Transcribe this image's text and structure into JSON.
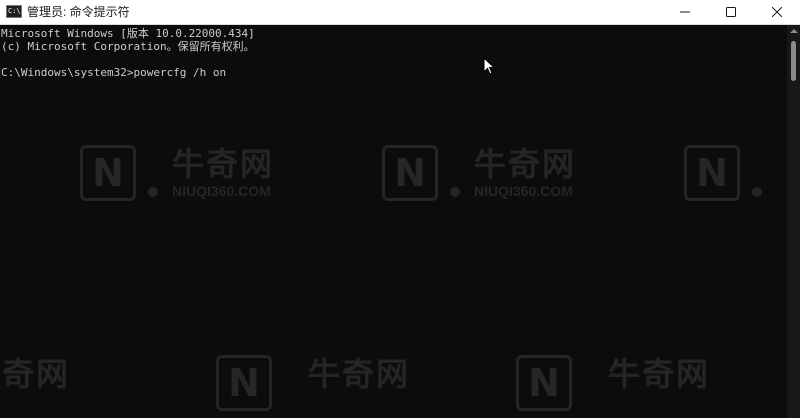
{
  "window": {
    "title": "管理员: 命令提示符",
    "app_icon_text": "C:\\",
    "controls": {
      "minimize_icon": "minimize-icon",
      "maximize_icon": "maximize-icon",
      "close_icon": "close-icon"
    }
  },
  "console": {
    "lines": [
      "Microsoft Windows [版本 10.0.22000.434]",
      "(c) Microsoft Corporation。保留所有权利。",
      "",
      "C:\\Windows\\system32>powercfg /h on"
    ]
  },
  "watermark": {
    "logo_letter": "N",
    "brand": "牛奇网",
    "url": "NIUQI360.COM",
    "fragment": "奇网"
  },
  "colors": {
    "console_bg": "#0c0c0c",
    "console_text": "#cccccc",
    "titlebar_bg": "#ffffff"
  }
}
